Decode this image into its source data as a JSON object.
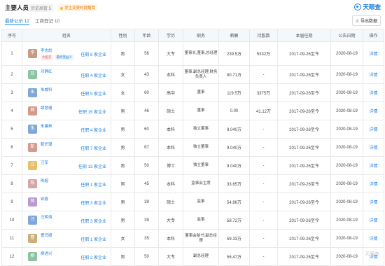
{
  "header": {
    "title": "主要人员",
    "history_button": "历史高管 5",
    "monitor_button": "发生变更时提醒我",
    "brand": "天眼查",
    "export_button": "导出数据"
  },
  "tabs": [
    {
      "label": "最新公示 12"
    },
    {
      "label": "工商登记 10"
    }
  ],
  "table": {
    "headers": [
      "序号",
      "姓名",
      "性别",
      "年龄",
      "学历",
      "职务",
      "薪酬",
      "持股数",
      "本届任期",
      "公告日期",
      "操作"
    ],
    "rows": [
      {
        "no": "1",
        "avatar": "李",
        "avatar_color": "#c69b82",
        "name": "李志彪",
        "link": "任职 8 家企业",
        "tags": [
          "大股东",
          "最终受益人"
        ],
        "gender": "男",
        "age": "56",
        "edu": "大专",
        "position": "董事长,董事,总经理",
        "salary": "239.5万",
        "shares": "5332万",
        "term": "2017-09-26至今",
        "date": "2020-08-19",
        "op": "详情"
      },
      {
        "no": "2",
        "avatar": "邓",
        "avatar_color": "#8bc4a1",
        "name": "邓静红",
        "link": "任职 4 家企业",
        "tags": [],
        "gender": "女",
        "age": "43",
        "edu": "本科",
        "position": "董事,副总经理,财务负责人",
        "salary": "80.71万",
        "shares": "-",
        "term": "2017-09-26至今",
        "date": "2020-08-19",
        "op": "详情"
      },
      {
        "no": "3",
        "avatar": "朱",
        "avatar_color": "#7fa8d9",
        "name": "朱威科",
        "link": "任职 9 家企业",
        "tags": [],
        "gender": "女",
        "age": "60",
        "edu": "高中",
        "position": "董事",
        "salary": "119.5万",
        "shares": "3375万",
        "term": "2017-09-26至今",
        "date": "2020-08-19",
        "op": "详情"
      },
      {
        "no": "4",
        "avatar": "薛",
        "avatar_color": "#d49a8e",
        "name": "薛慧瑾",
        "link": "任职 15 家企业",
        "tags": [],
        "gender": "男",
        "age": "46",
        "edu": "硕士",
        "position": "董事",
        "salary": "0.00",
        "shares": "41.12万",
        "term": "2017-09-26至今",
        "date": "2020-08-19",
        "op": "详情"
      },
      {
        "no": "5",
        "avatar": "朱",
        "avatar_color": "#7fa8d9",
        "name": "朱建林",
        "link": "任职 4 家企业",
        "tags": [],
        "gender": "男",
        "age": "60",
        "edu": "本科",
        "position": "独立董事",
        "salary": "9.040万",
        "shares": "-",
        "term": "2017-09-26至今",
        "date": "2020-08-19",
        "op": "详情"
      },
      {
        "no": "6",
        "avatar": "靳",
        "avatar_color": "#d49a8e",
        "name": "靳炽瑾",
        "link": "任职 7 家企业",
        "tags": [],
        "gender": "男",
        "age": "67",
        "edu": "本科",
        "position": "独立董事",
        "salary": "9.040万",
        "shares": "-",
        "term": "2017-09-26至今",
        "date": "2020-08-19",
        "op": "详情"
      },
      {
        "no": "7",
        "avatar": "汪",
        "avatar_color": "#e6c06a",
        "name": "汪军",
        "link": "任职 13 家企业",
        "tags": [],
        "gender": "男",
        "age": "50",
        "edu": "博士",
        "position": "独立董事",
        "salary": "9.040万",
        "shares": "-",
        "term": "2017-09-26至今",
        "date": "2020-08-19",
        "op": "详情"
      },
      {
        "no": "8",
        "avatar": "陈",
        "avatar_color": "#d4a6a6",
        "name": "陈超",
        "link": "任职 1 家企业",
        "tags": [],
        "gender": "男",
        "age": "45",
        "edu": "本科",
        "position": "监事会主席",
        "salary": "33.65万",
        "shares": "-",
        "term": "2017-09-26至今",
        "date": "2020-08-19",
        "op": "详情"
      },
      {
        "no": "9",
        "avatar": "钟",
        "avatar_color": "#b99bd0",
        "name": "钟鑫",
        "link": "任职 3 家企业",
        "tags": [],
        "gender": "男",
        "age": "39",
        "edu": "硕士",
        "position": "监事",
        "salary": "54.86万",
        "shares": "-",
        "term": "2017-09-26至今",
        "date": "2020-08-19",
        "op": "详情"
      },
      {
        "no": "10",
        "avatar": "汪",
        "avatar_color": "#7fa8d9",
        "name": "汪明涛",
        "link": "任职 3 家企业",
        "tags": [],
        "gender": "男",
        "age": "39",
        "edu": "大专",
        "position": "监事",
        "salary": "58.72万",
        "shares": "-",
        "term": "2017-09-26至今",
        "date": "2020-08-19",
        "op": "详情"
      },
      {
        "no": "11",
        "avatar": "曹",
        "avatar_color": "#c9b07a",
        "name": "曹玛娅",
        "link": "任职 1 家企业",
        "tags": [],
        "gender": "女",
        "age": "35",
        "edu": "本科",
        "position": "董事会秘书,副总经理",
        "salary": "59.33万",
        "shares": "-",
        "term": "2017-09-26至今",
        "date": "2020-08-19",
        "op": "详情"
      },
      {
        "no": "12",
        "avatar": "柳",
        "avatar_color": "#8bc4a1",
        "name": "柳进兴",
        "link": "任职 2 家企业",
        "tags": [],
        "gender": "男",
        "age": "50",
        "edu": "大专",
        "position": "副总经理",
        "salary": "56.47万",
        "shares": "-",
        "term": "2017-09-26至今",
        "date": "2020-08-19",
        "op": "详情"
      }
    ]
  },
  "watermark": "天眼查"
}
